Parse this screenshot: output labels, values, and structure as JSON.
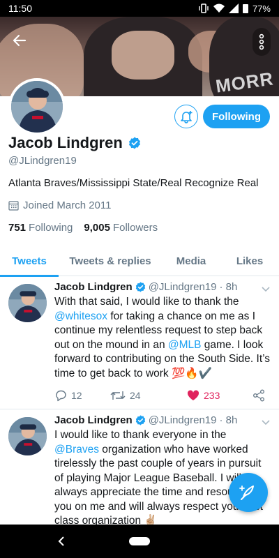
{
  "status_bar": {
    "time": "11:50",
    "battery": "77%"
  },
  "header": {
    "jersey_text": "MORR"
  },
  "profile": {
    "name": "Jacob Lindgren",
    "handle": "@JLindgren19",
    "bio": "Atlanta Braves/Mississippi State/Real Recognize Real",
    "joined": "Joined March 2011",
    "following_count": "751",
    "following_label": "Following",
    "followers_count": "9,005",
    "followers_label": "Followers",
    "following_button": "Following"
  },
  "tabs": [
    {
      "label": "Tweets",
      "active": true
    },
    {
      "label": "Tweets & replies",
      "active": false
    },
    {
      "label": "Media",
      "active": false
    },
    {
      "label": "Likes",
      "active": false
    }
  ],
  "tweets": [
    {
      "name": "Jacob Lindgren",
      "handle": "@JLindgren19",
      "time": "· 8h",
      "text_1": "With that said, I would like to thank the ",
      "mention_1": "@whitesox",
      "text_2": " for taking a chance on me as I continue my relentless request to step back out on the mound in an ",
      "mention_2": "@MLB",
      "text_3": " game. I look forward to contributing on the South Side. It’s time to get back to work 💯🔥✔️",
      "replies": "12",
      "retweets": "24",
      "likes": "233"
    },
    {
      "name": "Jacob Lindgren",
      "handle": "@JLindgren19",
      "time": "· 8h",
      "text_1": "I would like to thank everyone in the ",
      "mention_1": "@Braves",
      "text_2": " organization who have worked tirelessly the past couple of years in pursuit of playing Major League Baseball. I will always appreciate the time and resources you",
      "text_3": " on me and will always respect your first class organization ✌🏼"
    }
  ],
  "colors": {
    "accent": "#1da1f2",
    "like": "#e0245e",
    "secondary_text": "#657786"
  }
}
